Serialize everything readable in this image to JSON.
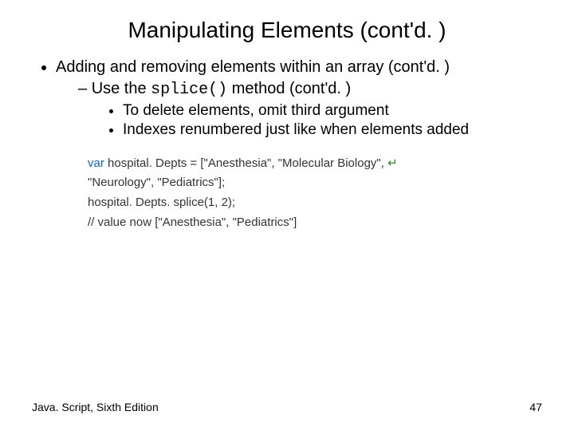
{
  "title": "Manipulating Elements (cont'd. )",
  "bullet": {
    "l1": "Adding and removing elements within an array (cont'd. )",
    "l2_pre": "Use the ",
    "l2_code": "splice()",
    "l2_post": " method (cont'd. )",
    "l3a": "To delete elements, omit third argument",
    "l3b": "Indexes renumbered just like when elements added"
  },
  "code": {
    "kw": "var",
    "line1_rest": " hospital. Depts = [\"Anesthesia\", \"Molecular Biology\", ",
    "line1_arrow": "↵",
    "line2": "\"Neurology\", \"Pediatrics\"];",
    "line3": "hospital. Depts. splice(1, 2);",
    "line4": "// value now [\"Anesthesia\", \"Pediatrics\"]"
  },
  "footer": {
    "left": "Java. Script, Sixth Edition",
    "right": "47"
  }
}
